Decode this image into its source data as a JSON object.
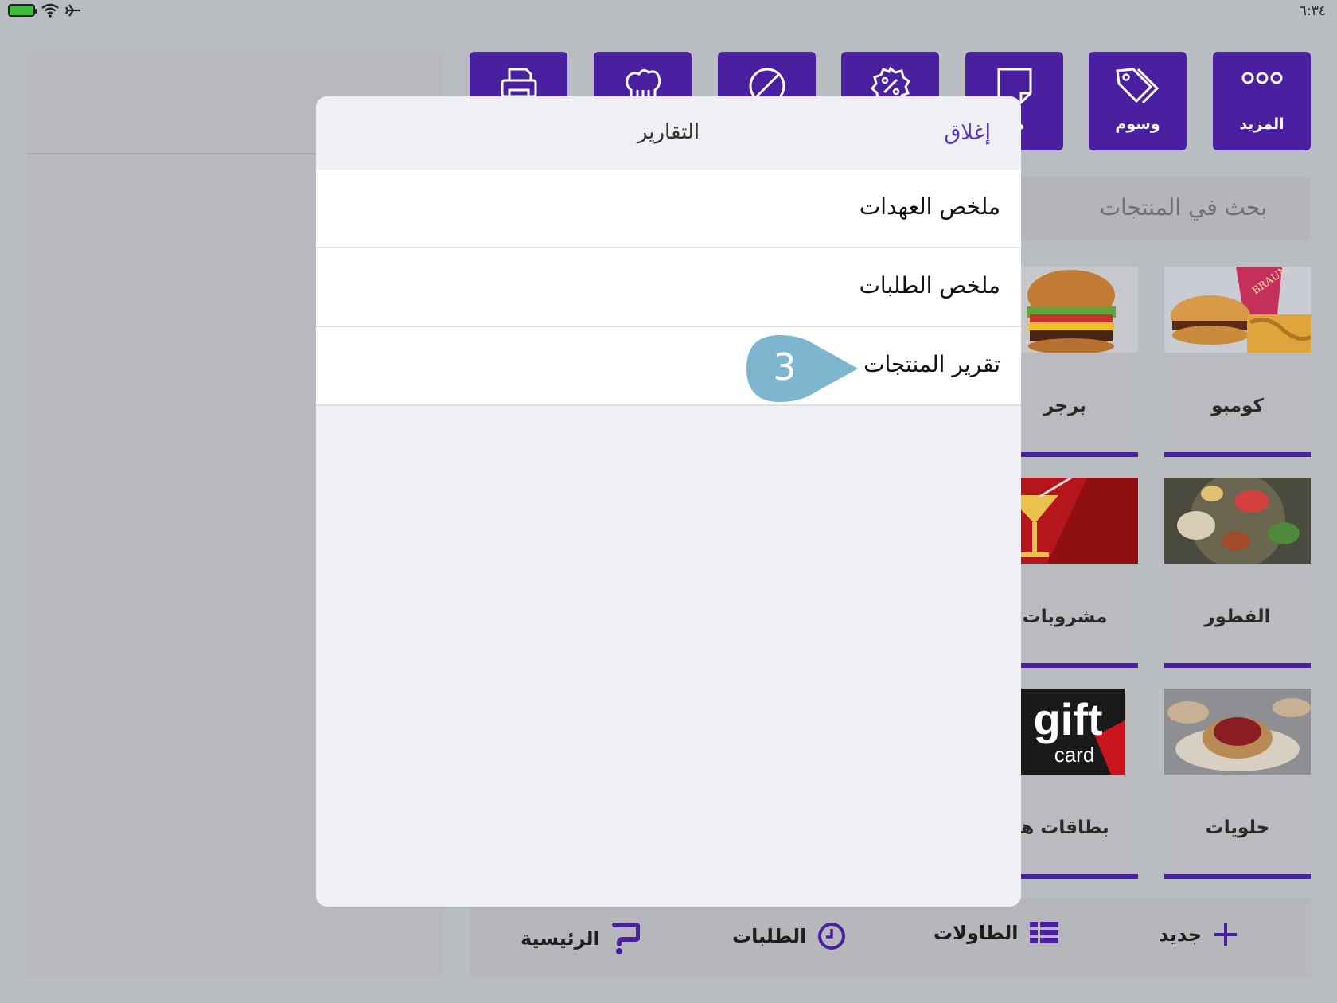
{
  "status": {
    "time": "٦:٣٤",
    "colors": {
      "battery": "#3bbf3b"
    }
  },
  "toolbar": {
    "buttons": [
      {
        "label": "المزيد",
        "icon": "more-icon"
      },
      {
        "label": "وسوم",
        "icon": "tag-icon"
      },
      {
        "label": "ملا",
        "icon": "note-icon"
      },
      {
        "label": "",
        "icon": "discount-icon"
      },
      {
        "label": "",
        "icon": "void-icon"
      },
      {
        "label": "",
        "icon": "chef-hat-icon"
      },
      {
        "label": "",
        "icon": "printer-icon"
      }
    ]
  },
  "search": {
    "placeholder": "بحث في المنتجات"
  },
  "categories": [
    {
      "label": "كومبو"
    },
    {
      "label": "برجر"
    },
    {
      "label": "الفطور"
    },
    {
      "label": "مشروبات"
    },
    {
      "label": "حلويات"
    },
    {
      "label": "بطاقات هدا"
    }
  ],
  "gift_card": {
    "line1": "gift",
    "line2": "card"
  },
  "combo_cup_text": "BRAUM'S",
  "bottom_nav": [
    {
      "label": "جديد",
      "icon": "plus-icon"
    },
    {
      "label": "الطاولات",
      "icon": "tables-icon"
    },
    {
      "label": "الطلبات",
      "icon": "clock-icon"
    },
    {
      "label": "الرئيسية",
      "icon": "home-logo-icon"
    }
  ],
  "modal": {
    "title": "التقارير",
    "close_label": "إغلاق",
    "rows": [
      {
        "label": "ملخص العهدات"
      },
      {
        "label": "ملخص الطلبات"
      },
      {
        "label": "تقرير المنتجات"
      }
    ]
  },
  "callout": {
    "number": "3"
  },
  "colors": {
    "accent": "#4b20a0",
    "link": "#5a34c0",
    "callout": "#7fb6cf"
  }
}
